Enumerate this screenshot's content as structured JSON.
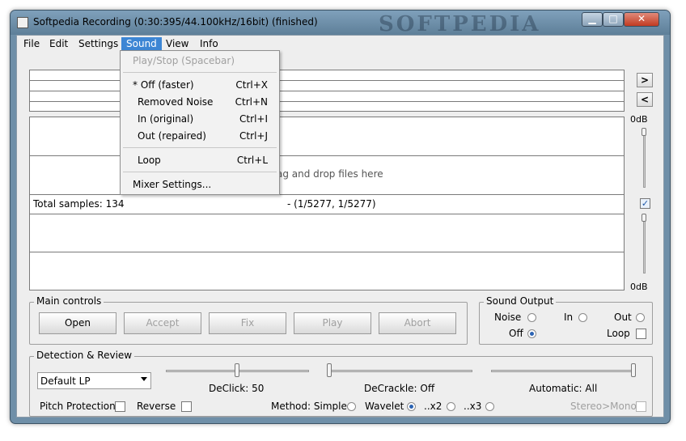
{
  "window": {
    "title": "Softpedia Recording (0:30:395/44.100kHz/16bit) (finished)",
    "watermark": "SOFTPEDIA",
    "controls": {
      "minimize": "▁",
      "maximize": "□",
      "close": "✕"
    }
  },
  "menubar": {
    "items": [
      "File",
      "Edit",
      "Settings",
      "Sound",
      "View",
      "Info"
    ],
    "active": "Sound"
  },
  "sound_menu": {
    "play_stop": {
      "label": "Play/Stop (Spacebar)",
      "enabled": false
    },
    "items": [
      {
        "label": "* Off (faster)",
        "shortcut": "Ctrl+X"
      },
      {
        "label": "Removed Noise",
        "shortcut": "Ctrl+N"
      },
      {
        "label": "In (original)",
        "shortcut": "Ctrl+I"
      },
      {
        "label": "Out (repaired)",
        "shortcut": "Ctrl+J"
      }
    ],
    "loop": {
      "label": "Loop",
      "shortcut": "Ctrl+L"
    },
    "mixer": {
      "label": "Mixer Settings..."
    }
  },
  "waveform": {
    "drop_hint": "ag and drop files here",
    "info_start": "Total samples: 134",
    "info_end": "- (1/5277, 1/5277)",
    "db_top": "0dB",
    "db_bottom": "0dB",
    "side_next": ">",
    "side_prev": "<"
  },
  "main_controls": {
    "title": "Main controls",
    "buttons": {
      "open": "Open",
      "accept": "Accept",
      "fix": "Fix",
      "play": "Play",
      "abort": "Abort"
    }
  },
  "sound_output": {
    "title": "Sound Output",
    "noise": "Noise",
    "in": "In",
    "out": "Out",
    "off": "Off",
    "loop": "Loop",
    "selected": "Off"
  },
  "detection": {
    "title": "Detection & Review",
    "preset": "Default LP",
    "declick_label": "DeClick: 50",
    "decrackle_label": "DeCrackle: Off",
    "automatic_label": "Automatic: All",
    "pitch_protection": "Pitch Protection",
    "reverse": "Reverse",
    "method_label": "Method: Simple",
    "wavelet": "Wavelet",
    "x2": "..x2",
    "x3": "..x3",
    "stereo_mono": "Stereo>Mono",
    "method_selected": "Wavelet"
  },
  "colors": {
    "menu_highlight": "#3d86d4",
    "window_frame": "#6f8fa8",
    "panel_bg": "#eeeeee"
  }
}
